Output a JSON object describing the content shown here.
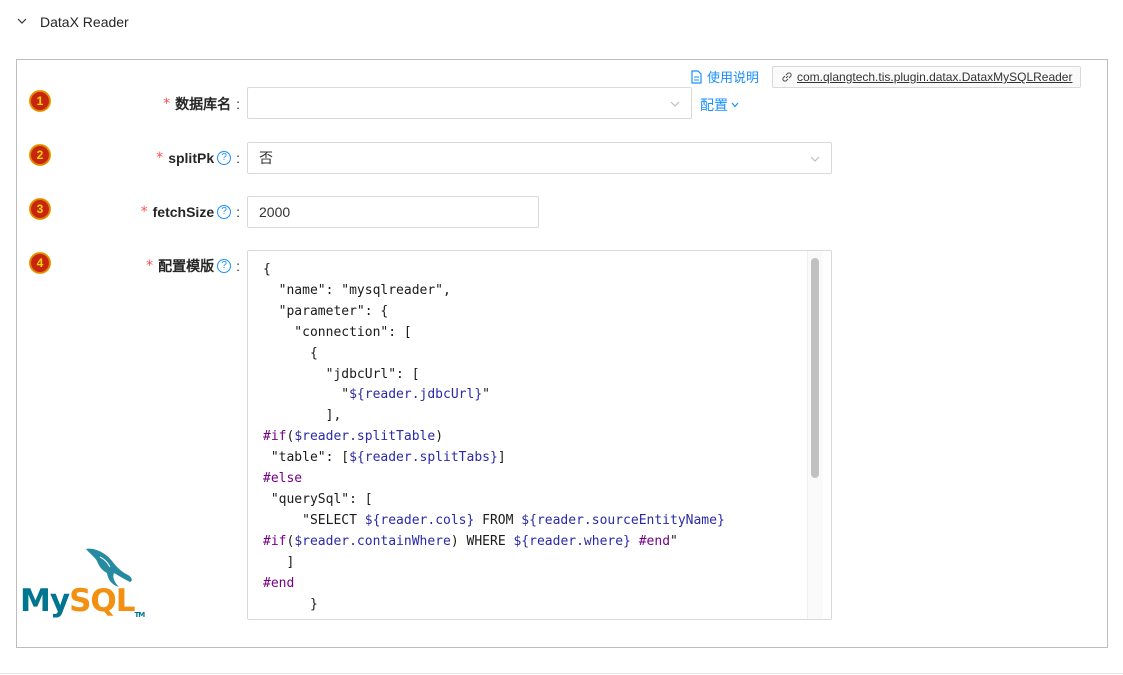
{
  "section": {
    "title": "DataX Reader"
  },
  "toolbar": {
    "doc_label": "使用说明",
    "plugin_class": "com.qlangtech.tis.plugin.datax.DataxMySQLReader"
  },
  "fields": [
    {
      "index": "1",
      "label": "数据库名",
      "value": "",
      "link": "配置"
    },
    {
      "index": "2",
      "label": "splitPk",
      "value": "否"
    },
    {
      "index": "3",
      "label": "fetchSize",
      "value": "2000"
    },
    {
      "index": "4",
      "label": "配置模版"
    }
  ],
  "required_mark": "*",
  "colon": ":",
  "help_glyph": "?",
  "template_code": [
    "{",
    "  \"name\": \"mysqlreader\",",
    "  \"parameter\": {",
    "    \"connection\": [",
    "      {",
    "        \"jdbcUrl\": [",
    "          \"${reader.jdbcUrl}\"",
    "        ],",
    "#if($reader.splitTable)",
    " \"table\": [${reader.splitTabs}]",
    "#else",
    " \"querySql\": [",
    "     \"SELECT ${reader.cols} FROM ${reader.sourceEntityName}",
    "#if($reader.containWhere) WHERE ${reader.where} #end\"",
    "   ]",
    "#end",
    "      }"
  ],
  "logo": {
    "text_my": "My",
    "text_sql": "SQL",
    "tm": "TM"
  },
  "colors": {
    "accent": "#1890ff",
    "required": "#ff4d4f",
    "badge": "#c8250f",
    "badge_text": "#ffd800",
    "mysql_blue": "#00758f",
    "mysql_orange": "#f29111"
  }
}
